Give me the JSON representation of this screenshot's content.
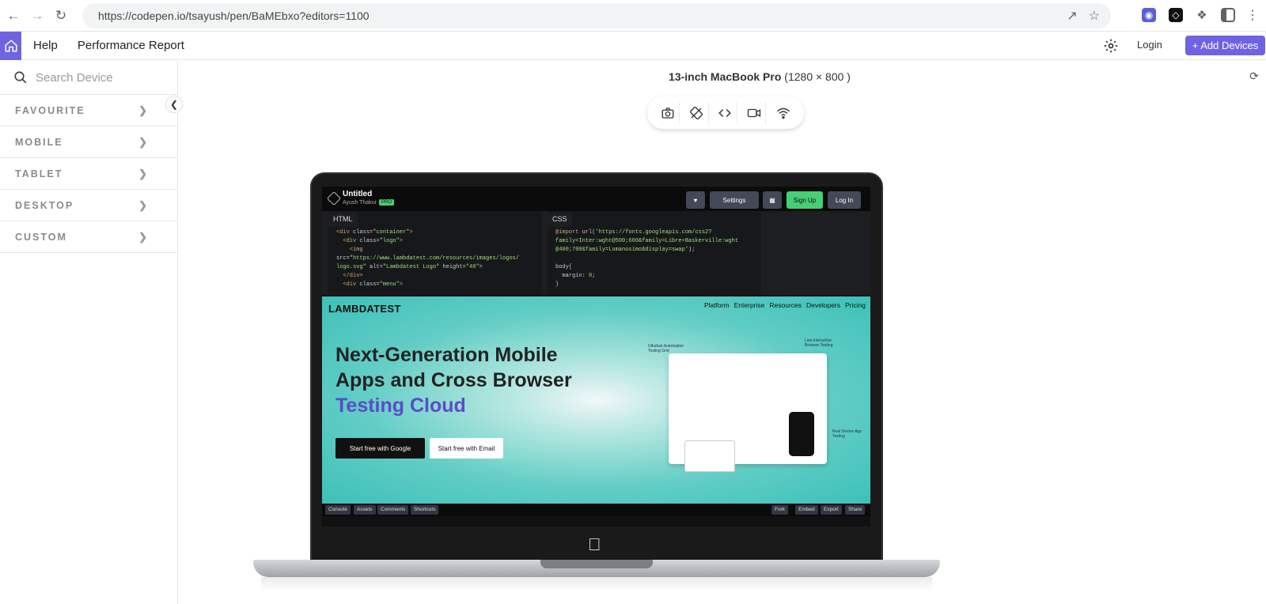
{
  "browser": {
    "url": "https://codepen.io/tsayush/pen/BaMEbxo?editors=1100"
  },
  "header": {
    "help": "Help",
    "performance_report": "Performance Report",
    "login": "Login",
    "add_devices": "+ Add Devices"
  },
  "sidebar": {
    "search_placeholder": "Search Device",
    "categories": [
      "FAVOURITE",
      "MOBILE",
      "TABLET",
      "DESKTOP",
      "CUSTOM"
    ]
  },
  "device": {
    "name": "13-inch MacBook Pro",
    "resolution": "(1280 × 800 )"
  },
  "codepen": {
    "title": "Untitled",
    "author": "Ayush Thakur",
    "badge": "PRO",
    "settings": "Settings",
    "signup": "Sign Up",
    "login": "Log In",
    "html_tab": "HTML",
    "css_tab": "CSS",
    "footer_left": [
      "Console",
      "Assets",
      "Comments",
      "Shortcuts"
    ],
    "footer_right": [
      "Fork",
      "Embed",
      "Export",
      "Share"
    ]
  },
  "lambdatest": {
    "logo": "LAMBDATEST",
    "nav": [
      "Platform",
      "Enterprise",
      "Resources",
      "Developers",
      "Pricing"
    ],
    "headline_1": "Next-Generation Mobile",
    "headline_2": "Apps and Cross Browser",
    "headline_accent": "Testing Cloud",
    "cta_google": "Start free with Google",
    "cta_email": "Start free with Email",
    "note_1": "Ultrafast Automation Testing Grid",
    "note_2": "Live-Interactive Browser Testing",
    "note_3": "Real Device App Testing"
  },
  "colors": {
    "accent": "#6f63e3",
    "lambdatest_teal": "#3cc1b8",
    "lambdatest_accent_text": "#5a4cc9"
  }
}
